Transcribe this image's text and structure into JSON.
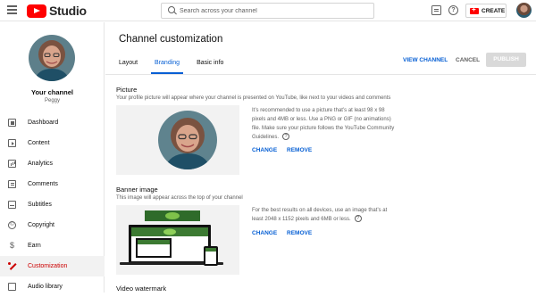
{
  "header": {
    "logo_text": "Studio",
    "search_placeholder": "Search across your channel",
    "create_label": "CREATE",
    "help_glyph": "?"
  },
  "sidebar": {
    "channel_title": "Your channel",
    "channel_name": "Peggy",
    "items": [
      {
        "label": "Dashboard",
        "icon": "dashboard-icon"
      },
      {
        "label": "Content",
        "icon": "content-icon"
      },
      {
        "label": "Analytics",
        "icon": "analytics-icon"
      },
      {
        "label": "Comments",
        "icon": "comments-icon"
      },
      {
        "label": "Subtitles",
        "icon": "subtitles-icon"
      },
      {
        "label": "Copyright",
        "icon": "copyright-icon"
      },
      {
        "label": "Earn",
        "icon": "earn-icon"
      },
      {
        "label": "Customization",
        "icon": "customization-icon",
        "active": true
      },
      {
        "label": "Audio library",
        "icon": "audio-library-icon"
      }
    ]
  },
  "main": {
    "title": "Channel customization",
    "tabs": [
      {
        "label": "Layout"
      },
      {
        "label": "Branding",
        "active": true
      },
      {
        "label": "Basic info"
      }
    ],
    "actions": {
      "view_channel": "VIEW CHANNEL",
      "cancel": "CANCEL",
      "publish": "PUBLISH"
    },
    "picture": {
      "title": "Picture",
      "description": "Your profile picture will appear where your channel is presented on YouTube, like next to your videos and comments",
      "help": "It’s recommended to use a picture that’s at least 98 x 98 pixels and 4MB or less. Use a PNG or GIF (no animations) file. Make sure your picture follows the YouTube Community Guidelines.",
      "change": "CHANGE",
      "remove": "REMOVE"
    },
    "banner": {
      "title": "Banner image",
      "description": "This image will appear across the top of your channel",
      "help": "For the best results on all devices, use an image that’s at least 2048 x 1152 pixels and 6MB or less.",
      "change": "CHANGE",
      "remove": "REMOVE"
    },
    "watermark": {
      "title": "Video watermark"
    }
  },
  "colors": {
    "accent_blue": "#065fd4",
    "active_red": "#cc0000",
    "brand_red": "#ff0000"
  }
}
